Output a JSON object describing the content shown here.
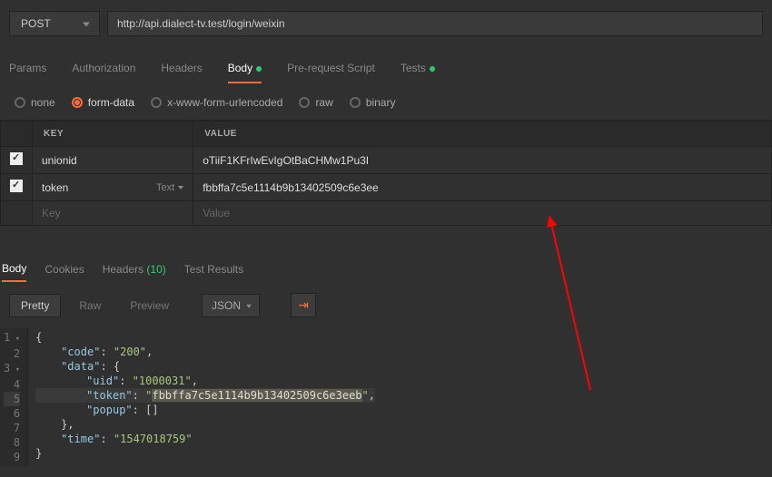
{
  "request": {
    "method": "POST",
    "url": "http://api.dialect-tv.test/login/weixin"
  },
  "tabs": {
    "params": "Params",
    "authorization": "Authorization",
    "headers": "Headers",
    "body": "Body",
    "prerequest": "Pre-request Script",
    "tests": "Tests"
  },
  "body_types": {
    "none": "none",
    "formdata": "form-data",
    "urlencoded": "x-www-form-urlencoded",
    "raw": "raw",
    "binary": "binary"
  },
  "columns": {
    "key": "KEY",
    "value": "VALUE"
  },
  "rows": [
    {
      "key": "unionid",
      "value": "oTiiF1KFrIwEvIgOtBaCHMw1Pu3I"
    },
    {
      "key": "token",
      "value": "fbbffa7c5e1114b9b13402509c6e3ee"
    }
  ],
  "row_hint": "Text",
  "placeholders": {
    "key": "Key",
    "value": "Value"
  },
  "response_tabs": {
    "body": "Body",
    "cookies": "Cookies",
    "headers_label": "Headers",
    "headers_count": "(10)",
    "test_results": "Test Results"
  },
  "viewer": {
    "pretty": "Pretty",
    "raw": "Raw",
    "preview": "Preview",
    "format": "JSON"
  },
  "json_tokens": {
    "code_k": "\"code\"",
    "code_v": "\"200\"",
    "data_k": "\"data\"",
    "uid_k": "\"uid\"",
    "uid_v": "\"1000031\"",
    "token_k": "\"token\"",
    "token_v_open": "\"",
    "token_v_hl": "fbbffa7c5e1114b9b13402509c6e3eeb",
    "token_v_close": "\"",
    "popup_k": "\"popup\"",
    "popup_v": "[]",
    "time_k": "\"time\"",
    "time_v": "\"1547018759\""
  },
  "chart_data": {
    "type": "table",
    "title": "JSON Response",
    "data": {
      "code": "200",
      "data": {
        "uid": "1000031",
        "token": "fbbffa7c5e1114b9b13402509c6e3eeb",
        "popup": []
      },
      "time": "1547018759"
    }
  }
}
